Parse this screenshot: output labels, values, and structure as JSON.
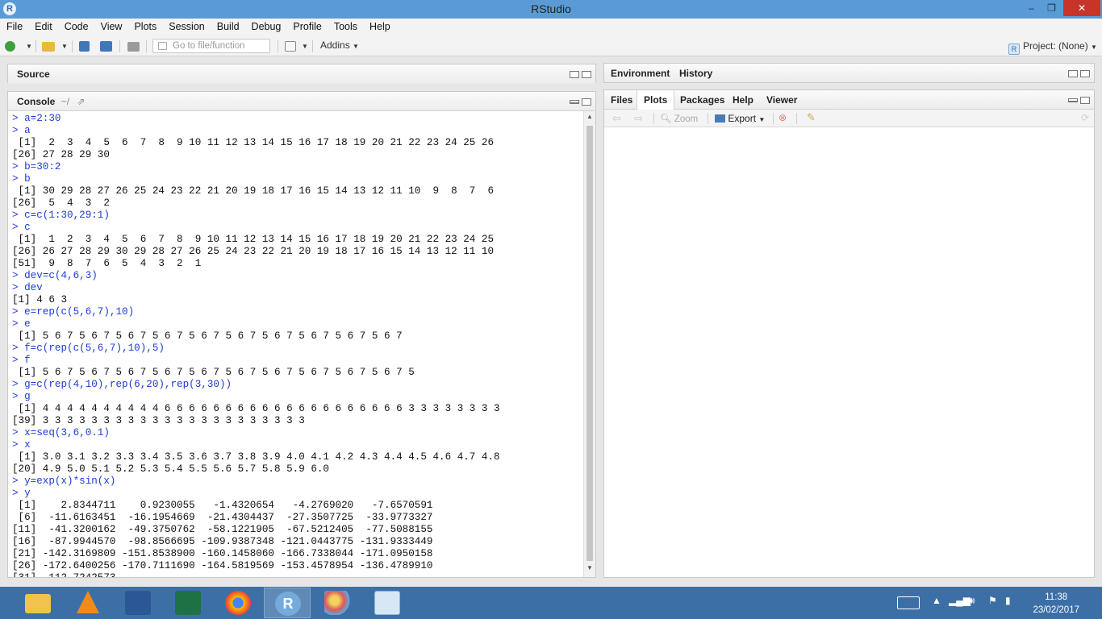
{
  "window": {
    "title": "RStudio",
    "minimize": "–",
    "maximize": "❐",
    "close": "✕"
  },
  "menu": [
    "File",
    "Edit",
    "Code",
    "View",
    "Plots",
    "Session",
    "Build",
    "Debug",
    "Profile",
    "Tools",
    "Help"
  ],
  "toolbar": {
    "goto_placeholder": "Go to file/function",
    "addins_label": "Addins",
    "project_label": "Project: (None)"
  },
  "source_pane": {
    "label": "Source"
  },
  "console_pane": {
    "label": "Console",
    "path": "~/",
    "lines": [
      {
        "t": "cmd",
        "s": "> a=2:30"
      },
      {
        "t": "cmd",
        "s": "> a"
      },
      {
        "t": "out",
        "s": " [1]  2  3  4  5  6  7  8  9 10 11 12 13 14 15 16 17 18 19 20 21 22 23 24 25 26"
      },
      {
        "t": "out",
        "s": "[26] 27 28 29 30"
      },
      {
        "t": "cmd",
        "s": "> b=30:2"
      },
      {
        "t": "cmd",
        "s": "> b"
      },
      {
        "t": "out",
        "s": " [1] 30 29 28 27 26 25 24 23 22 21 20 19 18 17 16 15 14 13 12 11 10  9  8  7  6"
      },
      {
        "t": "out",
        "s": "[26]  5  4  3  2"
      },
      {
        "t": "cmd",
        "s": "> c=c(1:30,29:1)"
      },
      {
        "t": "cmd",
        "s": "> c"
      },
      {
        "t": "out",
        "s": " [1]  1  2  3  4  5  6  7  8  9 10 11 12 13 14 15 16 17 18 19 20 21 22 23 24 25"
      },
      {
        "t": "out",
        "s": "[26] 26 27 28 29 30 29 28 27 26 25 24 23 22 21 20 19 18 17 16 15 14 13 12 11 10"
      },
      {
        "t": "out",
        "s": "[51]  9  8  7  6  5  4  3  2  1"
      },
      {
        "t": "cmd",
        "s": "> dev=c(4,6,3)"
      },
      {
        "t": "cmd",
        "s": "> dev"
      },
      {
        "t": "out",
        "s": "[1] 4 6 3"
      },
      {
        "t": "cmd",
        "s": "> e=rep(c(5,6,7),10)"
      },
      {
        "t": "cmd",
        "s": "> e"
      },
      {
        "t": "out",
        "s": " [1] 5 6 7 5 6 7 5 6 7 5 6 7 5 6 7 5 6 7 5 6 7 5 6 7 5 6 7 5 6 7"
      },
      {
        "t": "cmd",
        "s": "> f=c(rep(c(5,6,7),10),5)"
      },
      {
        "t": "cmd",
        "s": "> f"
      },
      {
        "t": "out",
        "s": " [1] 5 6 7 5 6 7 5 6 7 5 6 7 5 6 7 5 6 7 5 6 7 5 6 7 5 6 7 5 6 7 5"
      },
      {
        "t": "cmd",
        "s": "> g=c(rep(4,10),rep(6,20),rep(3,30))"
      },
      {
        "t": "cmd",
        "s": "> g"
      },
      {
        "t": "out",
        "s": " [1] 4 4 4 4 4 4 4 4 4 4 6 6 6 6 6 6 6 6 6 6 6 6 6 6 6 6 6 6 6 6 3 3 3 3 3 3 3 3"
      },
      {
        "t": "out",
        "s": "[39] 3 3 3 3 3 3 3 3 3 3 3 3 3 3 3 3 3 3 3 3 3 3"
      },
      {
        "t": "cmd",
        "s": "> x=seq(3,6,0.1)"
      },
      {
        "t": "cmd",
        "s": "> x"
      },
      {
        "t": "out",
        "s": " [1] 3.0 3.1 3.2 3.3 3.4 3.5 3.6 3.7 3.8 3.9 4.0 4.1 4.2 4.3 4.4 4.5 4.6 4.7 4.8"
      },
      {
        "t": "out",
        "s": "[20] 4.9 5.0 5.1 5.2 5.3 5.4 5.5 5.6 5.7 5.8 5.9 6.0"
      },
      {
        "t": "cmd",
        "s": "> y=exp(x)*sin(x)"
      },
      {
        "t": "cmd",
        "s": "> y"
      },
      {
        "t": "out",
        "s": " [1]    2.8344711    0.9230055   -1.4320654   -4.2769020   -7.6570591"
      },
      {
        "t": "out",
        "s": " [6]  -11.6163451  -16.1954669  -21.4304437  -27.3507725  -33.9773327"
      },
      {
        "t": "out",
        "s": "[11]  -41.3200162  -49.3750762  -58.1221905  -67.5212405  -77.5088155"
      },
      {
        "t": "out",
        "s": "[16]  -87.9944570  -98.8566695 -109.9387348 -121.0443775 -131.9333449"
      },
      {
        "t": "out",
        "s": "[21] -142.3169809 -151.8538900 -160.1458060 -166.7338044 -171.0950158"
      },
      {
        "t": "out",
        "s": "[26] -172.6400256 -170.7111690 -164.5819569 -153.4578954 -136.4789910"
      },
      {
        "t": "out",
        "s": "[31] -112.7242573"
      }
    ]
  },
  "env_pane": {
    "tabs": [
      "Environment",
      "History"
    ]
  },
  "files_pane": {
    "tabs": [
      "Files",
      "Plots",
      "Packages",
      "Help",
      "Viewer"
    ],
    "active_tab": "Plots",
    "zoom_label": "Zoom",
    "export_label": "Export"
  },
  "taskbar": {
    "time": "11:38",
    "date": "23/02/2017"
  },
  "colors": {
    "command": "#1d3bd4",
    "titlebar": "#5b9bd5",
    "taskbar": "#3c6fa6"
  }
}
